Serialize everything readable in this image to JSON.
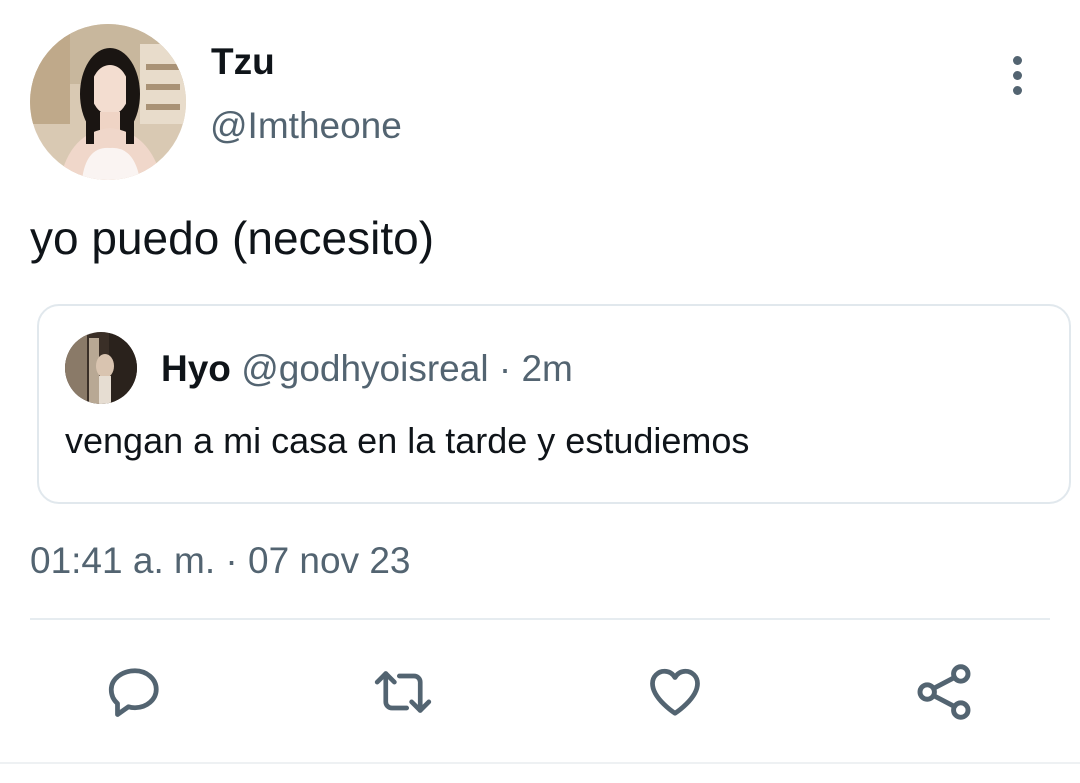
{
  "tweet": {
    "display_name": "Tzu",
    "handle": "@Imtheone",
    "text": "yo puedo (necesito)",
    "timestamp": "01:41 a. m. · 07 nov 23"
  },
  "quoted_tweet": {
    "display_name": "Hyo",
    "handle": "@godhyoisreal",
    "separator": "·",
    "time": "2m",
    "text": "vengan a mi casa en la tarde y estudiemos"
  },
  "actions": {
    "reply": "reply-icon",
    "retweet": "retweet-icon",
    "like": "heart-icon",
    "share": "share-icon"
  },
  "colors": {
    "text_primary": "#0f1419",
    "text_secondary": "#536471",
    "border": "#e1e8ed",
    "icon": "#536471"
  }
}
